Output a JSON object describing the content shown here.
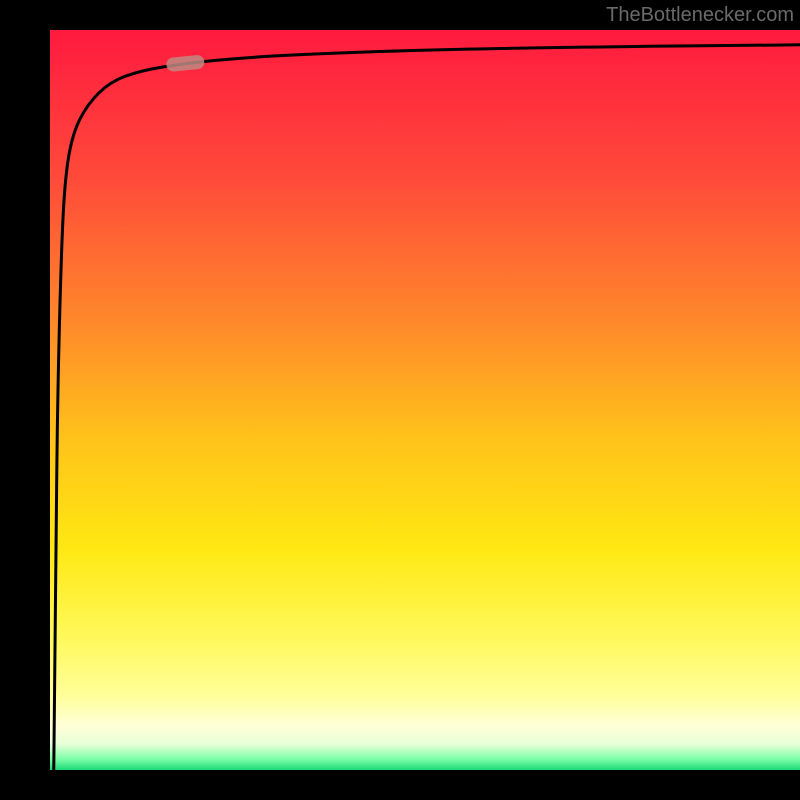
{
  "watermark": {
    "text": "TheBottlenecker.com"
  },
  "chart_data": {
    "type": "line",
    "title": "",
    "xlabel": "",
    "ylabel": "",
    "x_range": [
      0,
      100
    ],
    "y_range": [
      0,
      100
    ],
    "series": [
      {
        "name": "curve",
        "x": [
          0.5,
          0.6,
          0.8,
          1.0,
          1.5,
          2,
          3,
          5,
          8,
          12,
          18,
          25,
          35,
          50,
          70,
          100
        ],
        "y": [
          0,
          10,
          30,
          50,
          70,
          80,
          86,
          90,
          93,
          94.5,
          95.5,
          96.2,
          96.8,
          97.3,
          97.7,
          98
        ]
      }
    ],
    "marker": {
      "x": 18,
      "y": 95.5
    },
    "background": {
      "gradient_stops": [
        {
          "offset": 0.0,
          "color": "#ff1a3f"
        },
        {
          "offset": 0.2,
          "color": "#ff4a3a"
        },
        {
          "offset": 0.4,
          "color": "#ff8a2a"
        },
        {
          "offset": 0.55,
          "color": "#ffc21a"
        },
        {
          "offset": 0.7,
          "color": "#ffe812"
        },
        {
          "offset": 0.82,
          "color": "#fff85a"
        },
        {
          "offset": 0.9,
          "color": "#ffff9a"
        },
        {
          "offset": 0.94,
          "color": "#ffffd8"
        },
        {
          "offset": 0.965,
          "color": "#e8ffd8"
        },
        {
          "offset": 0.985,
          "color": "#7dffa8"
        },
        {
          "offset": 1.0,
          "color": "#1cd97a"
        }
      ]
    }
  }
}
